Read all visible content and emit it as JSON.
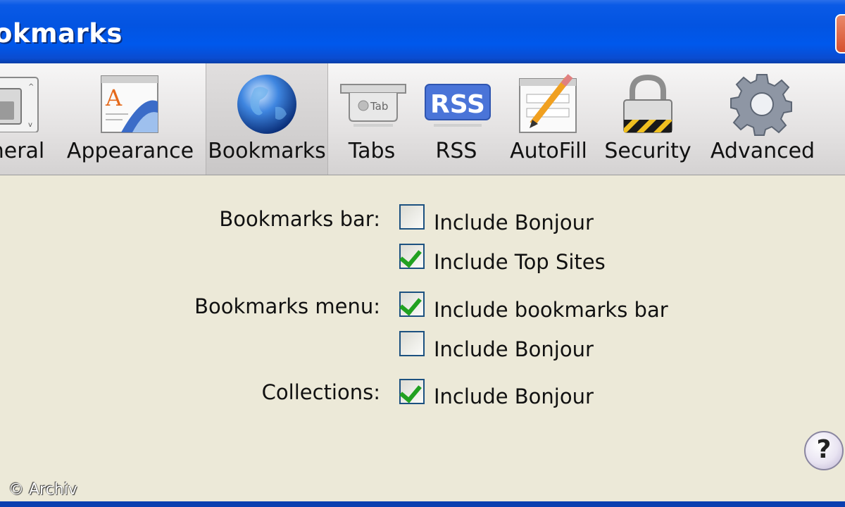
{
  "window": {
    "title": "okmarks"
  },
  "toolbar": {
    "items": [
      {
        "label": "neral",
        "icon": "switch-icon"
      },
      {
        "label": "Appearance",
        "icon": "font-appearance-icon"
      },
      {
        "label": "Bookmarks",
        "icon": "globe-icon",
        "selected": true
      },
      {
        "label": "Tabs",
        "icon": "tab-icon"
      },
      {
        "label": "RSS",
        "icon": "rss-icon"
      },
      {
        "label": "AutoFill",
        "icon": "pencil-form-icon"
      },
      {
        "label": "Security",
        "icon": "padlock-icon"
      },
      {
        "label": "Advanced",
        "icon": "gear-icon"
      }
    ],
    "tab_icon_text": "Tab",
    "rss_icon_text": "RSS",
    "appearance_icon_letter": "A"
  },
  "settings": {
    "bookmarks_bar": {
      "label": "Bookmarks bar:",
      "options": [
        {
          "label": "Include Bonjour",
          "checked": false
        },
        {
          "label": "Include Top Sites",
          "checked": true
        }
      ]
    },
    "bookmarks_menu": {
      "label": "Bookmarks menu:",
      "options": [
        {
          "label": "Include bookmarks bar",
          "checked": true
        },
        {
          "label": "Include Bonjour",
          "checked": false
        }
      ]
    },
    "collections": {
      "label": "Collections:",
      "options": [
        {
          "label": "Include Bonjour",
          "checked": true
        }
      ]
    }
  },
  "help": {
    "label": "?"
  },
  "watermark": "© Archiv",
  "colors": {
    "titlebar": "#0354e1",
    "check": "#21a121",
    "background": "#ece9d8"
  }
}
